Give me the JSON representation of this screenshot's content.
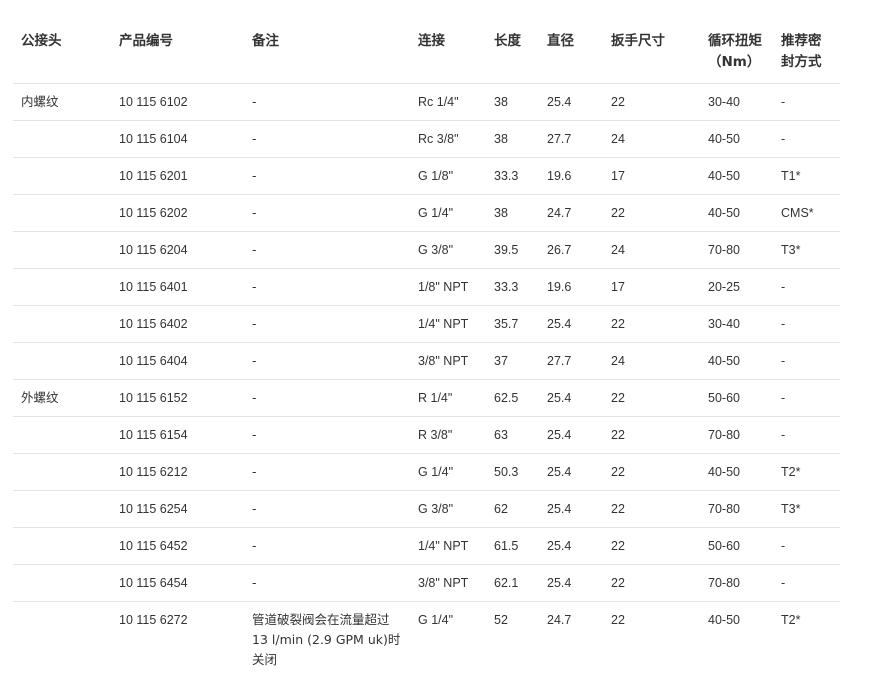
{
  "table": {
    "headers": [
      "公接头",
      "产品编号",
      "备注",
      "连接",
      "长度",
      "直径",
      "扳手尺寸",
      "循环扭矩（Nm）",
      "推荐密封方式"
    ],
    "rows": [
      [
        "内螺纹",
        "10 115 6102",
        "-",
        "Rc 1/4\"",
        "38",
        "25.4",
        "22",
        "30-40",
        "-"
      ],
      [
        "",
        "10 115 6104",
        "-",
        "Rc 3/8\"",
        "38",
        "27.7",
        "24",
        "40-50",
        "-"
      ],
      [
        "",
        "10 115 6201",
        "-",
        "G 1/8\"",
        "33.3",
        "19.6",
        "17",
        "40-50",
        "T1*"
      ],
      [
        "",
        "10 115 6202",
        "-",
        "G 1/4\"",
        "38",
        "24.7",
        "22",
        "40-50",
        "CMS*"
      ],
      [
        "",
        "10 115 6204",
        "-",
        "G 3/8\"",
        "39.5",
        "26.7",
        "24",
        "70-80",
        "T3*"
      ],
      [
        "",
        "10 115 6401",
        "-",
        "1/8\" NPT",
        "33.3",
        "19.6",
        "17",
        "20-25",
        "-"
      ],
      [
        "",
        "10 115 6402",
        "-",
        "1/4\" NPT",
        "35.7",
        "25.4",
        "22",
        "30-40",
        "-"
      ],
      [
        "",
        "10 115 6404",
        "-",
        "3/8\" NPT",
        "37",
        "27.7",
        "24",
        "40-50",
        "-"
      ],
      [
        "外螺纹",
        "10 115 6152",
        "-",
        "R 1/4\"",
        "62.5",
        "25.4",
        "22",
        "50-60",
        "-"
      ],
      [
        "",
        "10 115 6154",
        "-",
        "R 3/8\"",
        "63",
        "25.4",
        "22",
        "70-80",
        "-"
      ],
      [
        "",
        "10 115 6212",
        "-",
        "G 1/4\"",
        "50.3",
        "25.4",
        "22",
        "40-50",
        "T2*"
      ],
      [
        "",
        "10 115 6254",
        "-",
        "G 3/8\"",
        "62",
        "25.4",
        "22",
        "70-80",
        "T3*"
      ],
      [
        "",
        "10 115 6452",
        "-",
        "1/4\" NPT",
        "61.5",
        "25.4",
        "22",
        "50-60",
        "-"
      ],
      [
        "",
        "10 115 6454",
        "-",
        "3/8\" NPT",
        "62.1",
        "25.4",
        "22",
        "70-80",
        "-"
      ],
      [
        "",
        "10 115 6272",
        "管道破裂阀会在流量超过13 l/min (2.9 GPM uk)时关闭",
        "G 1/4\"",
        "52",
        "24.7",
        "22",
        "40-50",
        "T2*"
      ]
    ]
  }
}
